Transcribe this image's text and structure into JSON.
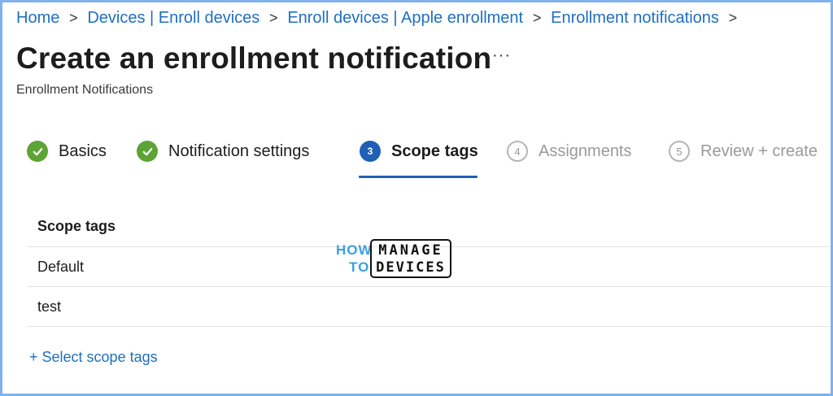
{
  "breadcrumb": {
    "items": [
      "Home",
      "Devices | Enroll devices",
      "Enroll devices | Apple enrollment",
      "Enrollment notifications"
    ],
    "separator": ">"
  },
  "header": {
    "title": "Create an enrollment notification",
    "more_label": "···",
    "subtitle": "Enrollment Notifications"
  },
  "wizard": {
    "steps": [
      {
        "label": "Basics",
        "state": "completed",
        "marker": "check-icon"
      },
      {
        "label": "Notification settings",
        "state": "completed",
        "marker": "check-icon"
      },
      {
        "label": "Scope tags",
        "state": "current",
        "number": "3"
      },
      {
        "label": "Assignments",
        "state": "pending",
        "number": "4"
      },
      {
        "label": "Review + create",
        "state": "pending",
        "number": "5"
      }
    ]
  },
  "scope_table": {
    "header": "Scope tags",
    "rows": [
      "Default",
      "test"
    ]
  },
  "actions": {
    "select_scope_tags": "+ Select scope tags"
  },
  "watermark": {
    "line1_left": "HOW",
    "line2_left": "TO",
    "line1_right": "MANAGE",
    "line2_right": "DEVICES"
  },
  "colors": {
    "link": "#1f6fc0",
    "completed": "#5ea335",
    "current": "#1f5fb5",
    "pending": "#9a9a9a",
    "frame_border": "#7fb2ea"
  }
}
